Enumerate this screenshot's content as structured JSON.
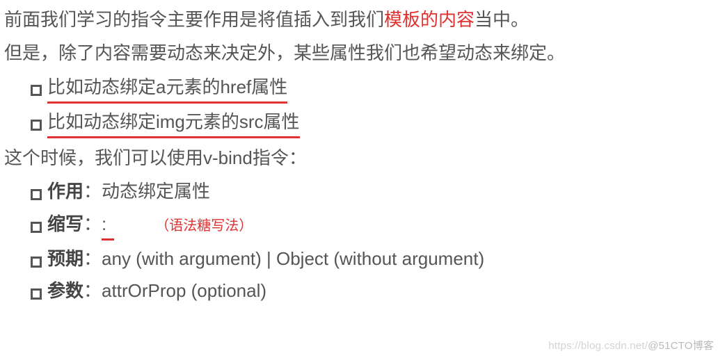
{
  "para1": {
    "before": "前面我们学习的指令主要作用是将值插入到我们",
    "highlight": "模板的内容",
    "after": "当中。"
  },
  "para2": "但是，除了内容需要动态来决定外，某些属性我们也希望动态来绑定。",
  "bullets1": [
    "比如动态绑定a元素的href属性",
    "比如动态绑定img元素的src属性"
  ],
  "para3": "这个时候，我们可以使用v-bind指令：",
  "details": {
    "item0": {
      "label": "作用",
      "value": "动态绑定属性"
    },
    "item1": {
      "label": "缩写",
      "value": ":",
      "annotation": "（语法糖写法）"
    },
    "item2": {
      "label": "预期",
      "value": "any (with argument) | Object (without argument)"
    },
    "item3": {
      "label": "参数",
      "value": "attrOrProp (optional)"
    }
  },
  "watermark": {
    "faint": "https://blog.csdn.net/",
    "overlay": "@51CTO博客"
  }
}
